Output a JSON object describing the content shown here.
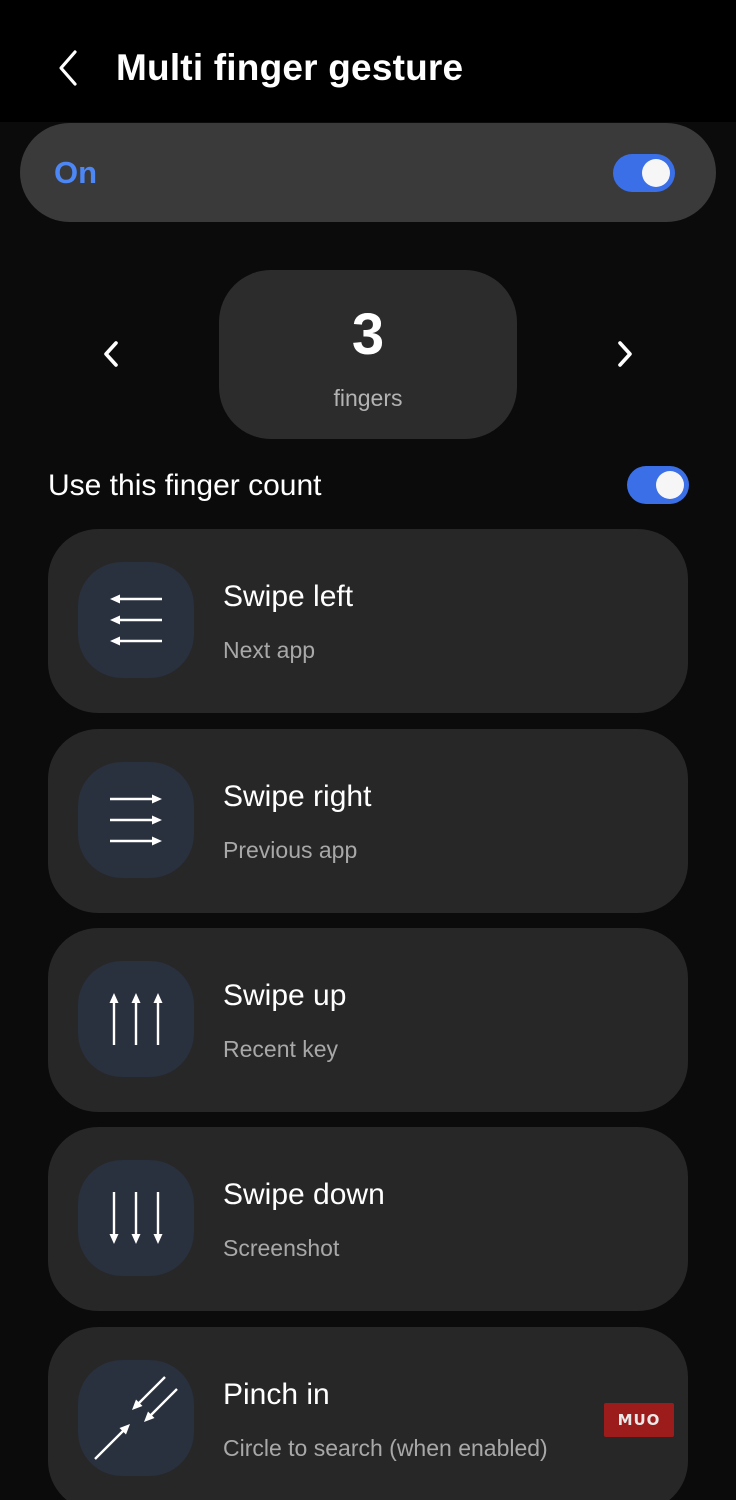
{
  "header": {
    "title": "Multi finger gesture",
    "back_icon": "chevron-left-icon"
  },
  "master_switch": {
    "label": "On",
    "enabled": true,
    "accent_color": "#4d86f5"
  },
  "finger_selector": {
    "count": "3",
    "unit": "fingers",
    "prev_icon": "chevron-left-icon",
    "next_icon": "chevron-right-icon"
  },
  "finger_count_setting": {
    "label": "Use this finger count",
    "enabled": true
  },
  "gestures": [
    {
      "title": "Swipe left",
      "action": "Next app",
      "icon": "swipe-left-icon"
    },
    {
      "title": "Swipe right",
      "action": "Previous app",
      "icon": "swipe-right-icon"
    },
    {
      "title": "Swipe up",
      "action": "Recent key",
      "icon": "swipe-up-icon"
    },
    {
      "title": "Swipe down",
      "action": "Screenshot",
      "icon": "swipe-down-icon"
    },
    {
      "title": "Pinch in",
      "action": "Circle to search (when enabled)",
      "icon": "pinch-in-icon"
    }
  ],
  "watermark": {
    "text": "MUO"
  },
  "colors": {
    "toggle_on": "#3a6fe8",
    "card_background": "#272727",
    "icon_background": "#29303e"
  }
}
